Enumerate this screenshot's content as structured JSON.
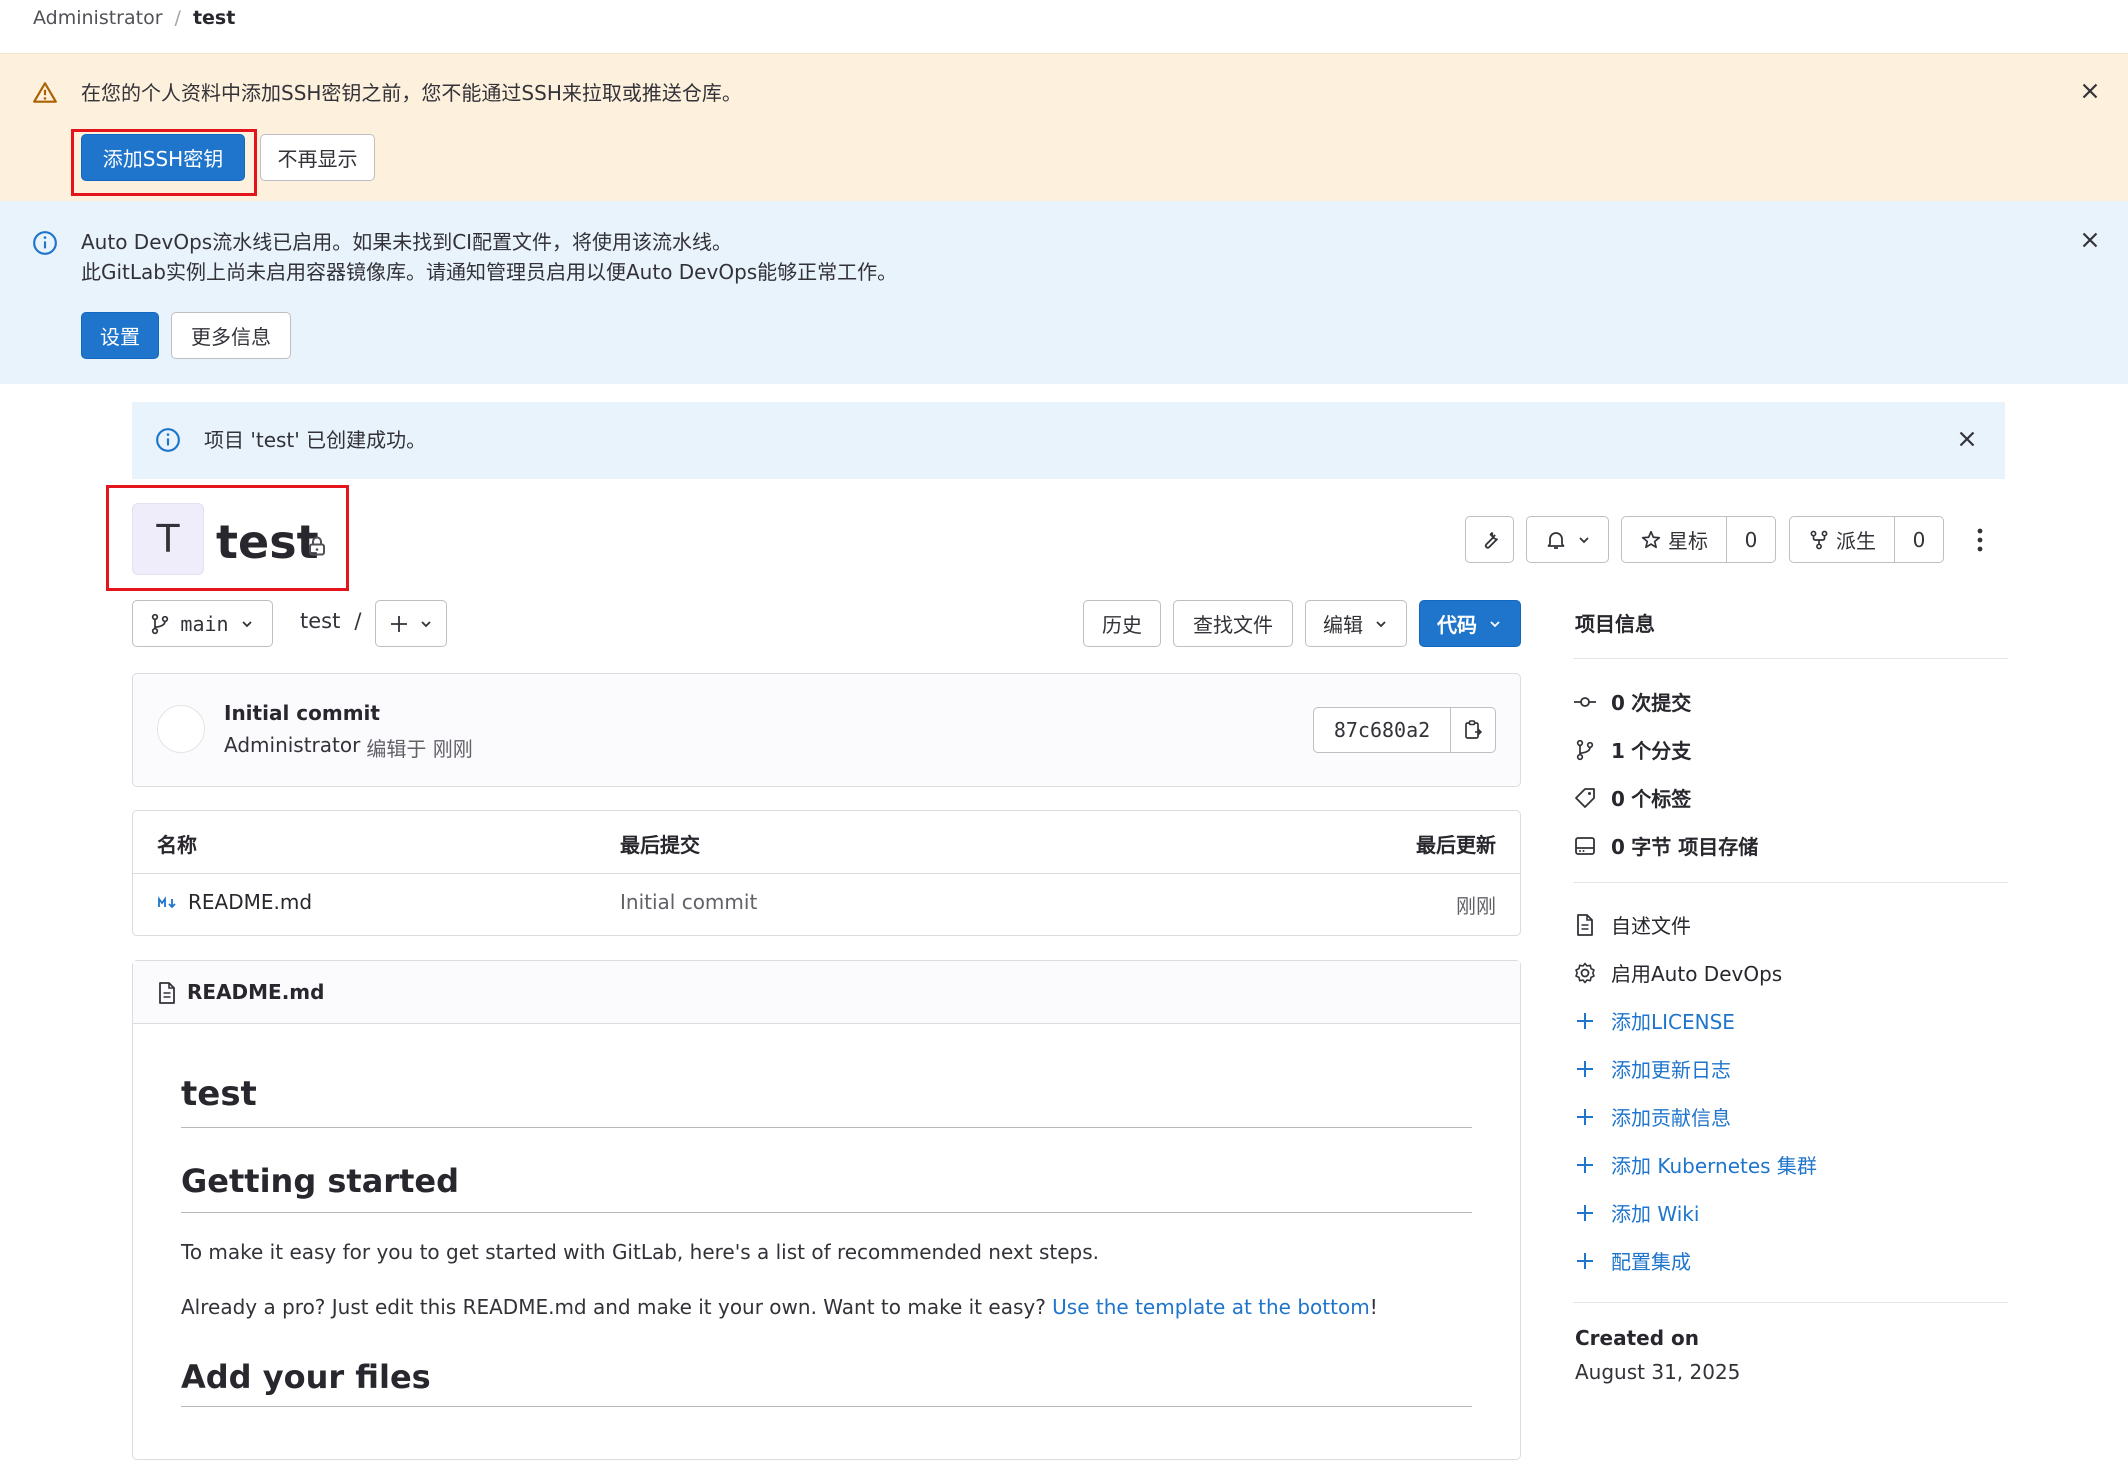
{
  "breadcrumb": {
    "parent": "Administrator",
    "separator": "/",
    "current": "test"
  },
  "ssh_banner": {
    "message": "在您的个人资料中添加SSH密钥之前，您不能通过SSH来拉取或推送仓库。",
    "primary_label": "添加SSH密钥",
    "secondary_label": "不再显示"
  },
  "devops_banner": {
    "line1": "Auto DevOps流水线已启用。如果未找到CI配置文件，将使用该流水线。",
    "line2": "此GitLab实例上尚未启用容器镜像库。请通知管理员启用以便Auto DevOps能够正常工作。",
    "primary_label": "设置",
    "secondary_label": "更多信息"
  },
  "success_alert": {
    "message": "项目 'test' 已创建成功。"
  },
  "project": {
    "avatar_letter": "T",
    "name": "test",
    "star_label": "星标",
    "star_count": "0",
    "fork_label": "派生",
    "fork_count": "0"
  },
  "repo_toolbar": {
    "branch": "main",
    "path": "test",
    "path_sep": "/",
    "history_label": "历史",
    "find_file_label": "查找文件",
    "edit_label": "编辑",
    "code_label": "代码"
  },
  "last_commit": {
    "title": "Initial commit",
    "author": "Administrator",
    "meta": "编辑于 刚刚",
    "sha": "87c680a2"
  },
  "file_table": {
    "headers": {
      "name": "名称",
      "last_commit": "最后提交",
      "last_update": "最后更新"
    },
    "rows": [
      {
        "name": "README.md",
        "commit": "Initial commit",
        "updated": "刚刚"
      }
    ]
  },
  "readme": {
    "filename": "README.md",
    "h1": "test",
    "h2_getting_started": "Getting started",
    "p1": "To make it easy for you to get started with GitLab, here's a list of recommended next steps.",
    "p2_before": "Already a pro? Just edit this README.md and make it your own. Want to make it easy? ",
    "p2_link": "Use the template at the bottom",
    "p2_after": "!",
    "h2_add_files": "Add your files"
  },
  "sidebar": {
    "title": "项目信息",
    "stats": [
      {
        "count": "0",
        "label": "次提交",
        "icon": "commit-icon"
      },
      {
        "count": "1",
        "label": "个分支",
        "icon": "branch-icon"
      },
      {
        "count": "0",
        "label": "个标签",
        "icon": "tag-icon"
      },
      {
        "count": "0",
        "label": "字节 项目存储",
        "icon": "storage-icon"
      }
    ],
    "readme_label": "自述文件",
    "autodevops_label": "启用Auto DevOps",
    "add_links": [
      "添加LICENSE",
      "添加更新日志",
      "添加贡献信息",
      "添加 Kubernetes 集群",
      "添加 Wiki",
      "配置集成"
    ],
    "created_on_label": "Created on",
    "created_on_date": "August 31, 2025"
  },
  "colors": {
    "primary": "#1f75cb",
    "warning_bg": "#fdf1dd",
    "info_bg": "#e9f3fc",
    "highlight": "#e3141c"
  }
}
